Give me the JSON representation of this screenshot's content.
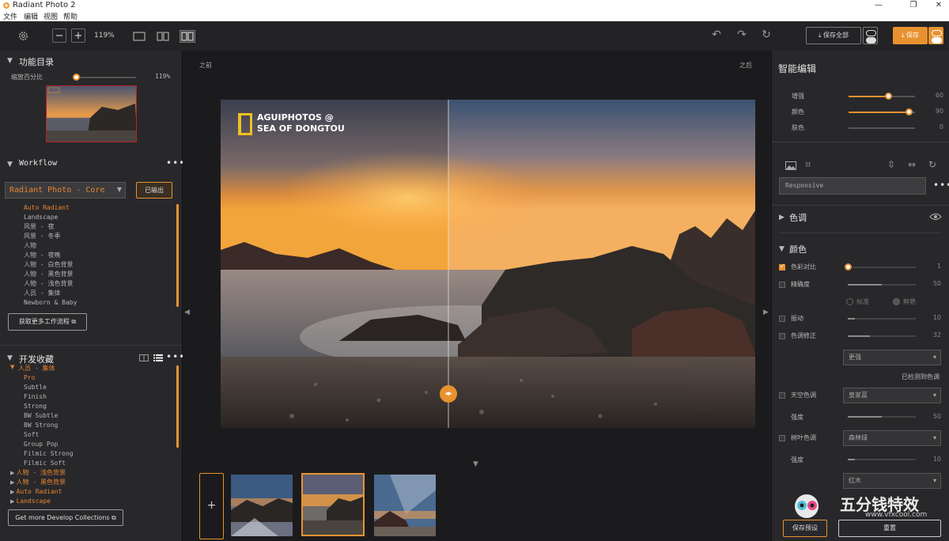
{
  "window": {
    "title": "Radiant Photo 2",
    "minimize": "—",
    "maximize": "❐",
    "close": "✕"
  },
  "menu": [
    "文件",
    "编辑",
    "视图",
    "帮助"
  ],
  "toolbar": {
    "zoom_minus": "−",
    "zoom_plus": "+",
    "zoom_level": "119%",
    "save_all_label": "保存全部",
    "save_label": "保存"
  },
  "left": {
    "catalog_title": "功能目录",
    "zoom_label": "缩放百分比",
    "zoom_value": "119%",
    "zoom_fraction": 0.05,
    "workflow_title": "Workflow",
    "workflow_select": "Radiant Photo - Core",
    "exported_button": "已输出",
    "workflow_items": [
      "Auto Radiant",
      "Landscape",
      "风景 - 夜",
      "风景 - 冬季",
      "人物",
      "人物 - 夜晚",
      "人物 - 白色背景",
      "人物 - 黑色背景",
      "人物 - 浅色背景",
      "人员 - 集体",
      "Newborn & Baby"
    ],
    "workflow_selected": 0,
    "get_more_workflows": "获取更多工作流程",
    "collections_title": "开发收藏",
    "collection_group": "人员 - 集体",
    "collection_items": [
      "Pro",
      "Subtle",
      "Finish",
      "Strong",
      "BW Subtle",
      "BW Strong",
      "Soft",
      "Group Pop",
      "Filmic Strong",
      "Filmic Soft"
    ],
    "collection_selected": 0,
    "collection_other_groups": [
      "人物 - 浅色背景",
      "人物 - 黑色背景",
      "Auto Radiant",
      "Landscape"
    ],
    "get_more_collections": "Get more Develop Collections"
  },
  "center": {
    "before_label": "之前",
    "after_label": "之后",
    "watermark_line1": "AGUIPHOTOS @",
    "watermark_line2": "SEA OF DONGTOU",
    "add_button": "+"
  },
  "right": {
    "smart_edit_title": "智能编辑",
    "smart_sliders": [
      {
        "label": "增强",
        "value": "60",
        "fraction": 0.6
      },
      {
        "label": "颜色",
        "value": "90",
        "fraction": 0.9
      },
      {
        "label": "肤色",
        "value": "0",
        "fraction": 0
      }
    ],
    "preset_field": "Responsive",
    "tone_title": "色调",
    "color_title": "颜色",
    "color_rows": [
      {
        "label": "色彩对比",
        "value": "1",
        "checked": true,
        "fraction": 0.0
      },
      {
        "label": "精确度",
        "value": "50",
        "checked": false,
        "fraction": 0.5
      },
      {
        "label": "振动",
        "value": "10",
        "checked": false,
        "fraction": 0.1
      },
      {
        "label": "色调修正",
        "value": "32",
        "checked": false,
        "fraction": 0.32
      }
    ],
    "radio_standard": "标准",
    "radio_fresh": "鲜艳",
    "tone_dropdown": "更强",
    "detected_text": "已检测到色调",
    "sky_label": "天空色调",
    "sky_dropdown": "皇家蓝",
    "strength_label": "强度",
    "sky_strength": "50",
    "sky_strength_fraction": 0.5,
    "foliage_label": "树叶色调",
    "foliage_dropdown": "森林绿",
    "foliage_strength": "10",
    "foliage_strength_fraction": 0.1,
    "third_dropdown": "红木",
    "save_preset_button": "保存预设",
    "reset_button": "重置",
    "watermark_cn": "五分钱特效",
    "watermark_url": "www.vfxcool.com"
  },
  "colors": {
    "accent": "#e8922f",
    "panel": "#28282b",
    "background": "#1b1b1d"
  }
}
